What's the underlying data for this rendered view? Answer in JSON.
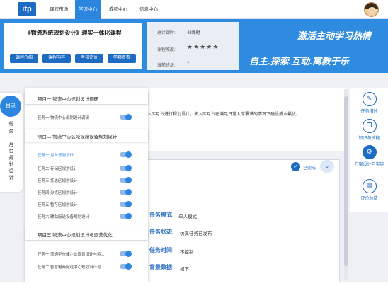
{
  "nav": {
    "logo": "itp",
    "tabs": [
      "课程市场",
      "学习中心",
      "成绩中心",
      "信息中心"
    ],
    "active_index": 1
  },
  "course": {
    "title": "《物流系统规划设计》理实一体化课程",
    "buttons": [
      "课程介绍",
      "课程内容",
      "考核评价",
      "学籍查看"
    ]
  },
  "info": {
    "total_hours_label": "总计课时:",
    "total_hours_value": "48课时",
    "difficulty_label": "课程难度:",
    "rating": 5,
    "class_label": "当前班级:",
    "class_value": "2"
  },
  "slogans": {
    "line1": "激活主动学习热情",
    "line2": "自主.探索.互动.寓教于乐"
  },
  "toc": {
    "circle_label": "目录",
    "vertical_text": "任务一月台规划设计"
  },
  "menu": {
    "projects": [
      {
        "title": "项目一 物流中心规划设计调研",
        "tasks": [
          "任务一 物流中心规划设计调研"
        ]
      },
      {
        "title": "项目二 物流中心区域设施设备规划设计",
        "tasks": [
          "任务一 月台规划设计",
          "任务二 存储区规划设计",
          "任务三 拣选区规划设计",
          "任务四 分拣区规划设计",
          "任务五 暂存区规划设计",
          "任务六 辅助配送设备规划设计"
        ]
      },
      {
        "title": "项目三 物流中心规划设计与运营优化",
        "tasks": [
          "任务一 流通型仓储企业规划设计与运...",
          "任务二 智慧电商配送中心规划设计与..."
        ]
      }
    ]
  },
  "content": {
    "intro_text": "入库月台进行规划设计，使入库月台在满足日常入库需求的情况下建设成本最优。",
    "done_label": "已完成",
    "fields": [
      {
        "label": "任务模式:",
        "value": "单人模式"
      },
      {
        "label": "任务状态:",
        "value": "仿真任务已发布"
      },
      {
        "label": "任务时间:",
        "value": "不控制"
      },
      {
        "label": "背景数据:",
        "value": "如下"
      }
    ]
  },
  "right_tools": [
    {
      "icon": "pen-icon",
      "label": "任务描述"
    },
    {
      "icon": "layers-icon",
      "label": "知识与技能"
    },
    {
      "icon": "gear-icon",
      "label": "方案设计与实施"
    },
    {
      "icon": "document-icon",
      "label": "评价总结"
    }
  ],
  "colors": {
    "primary": "#2c86e0",
    "dark_blue": "#1e6bc4"
  }
}
